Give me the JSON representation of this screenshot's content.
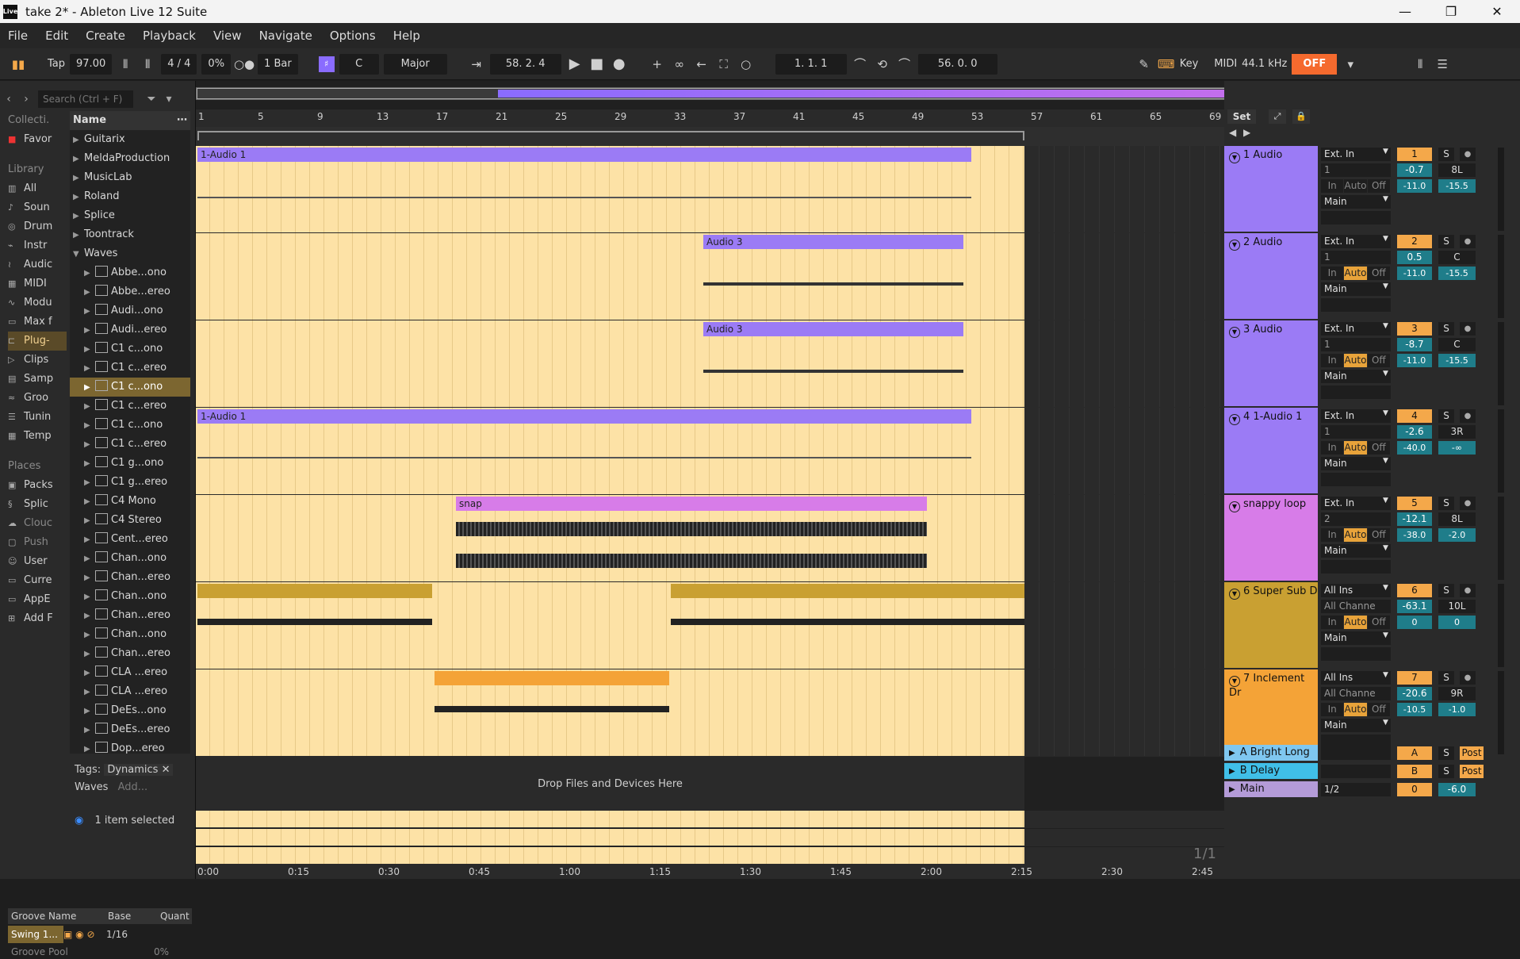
{
  "titlebar": {
    "title": "take 2* - Ableton Live 12 Suite",
    "logo": "Live",
    "min": "—",
    "max": "❐",
    "close": "✕"
  },
  "menu": [
    "File",
    "Edit",
    "Create",
    "Playback",
    "View",
    "Navigate",
    "Options",
    "Help"
  ],
  "control": {
    "tap": "Tap",
    "tempo": "97.00",
    "sig": "4 / 4",
    "groove": "0%",
    "quant": "1 Bar",
    "key": "C",
    "scale": "Major",
    "arr_pos": "58.  2.  4",
    "loop_start": "1.   1.   1",
    "loop_len": "56.   0.   0",
    "key_label": "Key",
    "midi_label": "MIDI",
    "sample_rate": "44.1 kHz",
    "off": "OFF"
  },
  "browser": {
    "search_placeholder": "Search (Ctrl + F)",
    "coll_header": "Collecti.",
    "fav": "Favor",
    "lib_header": "Library",
    "library": [
      "All",
      "Soun",
      "Drum",
      "Instr",
      "Audic",
      "MIDI",
      "Modu",
      "Max f",
      "Plug-",
      "Clips",
      "Samp",
      "Groo",
      "Tunin",
      "Temp"
    ],
    "places_header": "Places",
    "places": [
      "Packs",
      "Splic",
      "Clouc",
      "Push",
      "User",
      "Curre",
      "AppE",
      "Add F"
    ],
    "name_header": "Name",
    "folders": [
      "Guitarix",
      "MeldaProduction",
      "MusicLab",
      "Roland",
      "Splice",
      "Toontrack",
      "Waves"
    ],
    "items": [
      "Abbe...ono",
      "Abbe...ereo",
      "Audi...ono",
      "Audi...ereo",
      "C1 c...ono",
      "C1 c...ereo",
      "C1 c...ono",
      "C1 c...ereo",
      "C1 c...ono",
      "C1 c...ereo",
      "C1 g...ono",
      "C1 g...ereo",
      "C4 Mono",
      "C4 Stereo",
      "Cent...ereo",
      "Chan...ono",
      "Chan...ereo",
      "Chan...ono",
      "Chan...ereo",
      "Chan...ono",
      "Chan...ereo",
      "CLA ...ereo",
      "CLA ...ereo",
      "DeEs...ono",
      "DeEs...ereo",
      "Dop...ereo"
    ],
    "tags_label": "Tags:",
    "tag": "Dynamics",
    "tag_waves": "Waves",
    "tag_add": "Add...",
    "selected": "1 item selected",
    "groove_name": "Groove Name",
    "groove_base": "Base",
    "groove_quant": "Quant",
    "groove_item": "Swing 1...",
    "groove_val": "1/16",
    "groove_pool": "Groove Pool",
    "groove_pct": "0%"
  },
  "ruler": [
    "1",
    "5",
    "9",
    "13",
    "17",
    "21",
    "25",
    "29",
    "33",
    "37",
    "41",
    "45",
    "49",
    "53",
    "57",
    "61",
    "65",
    "69"
  ],
  "time": [
    "0:00",
    "0:15",
    "0:30",
    "0:45",
    "1:00",
    "1:15",
    "1:30",
    "1:45",
    "2:00",
    "2:15",
    "2:30",
    "2:45"
  ],
  "drop": "Drop Files and Devices Here",
  "ratio": "1/1",
  "set": "Set",
  "tracks": [
    {
      "name": "1 Audio",
      "color": "#9b7bf5",
      "in": "Ext. In",
      "ch": "1",
      "out": "Main",
      "num": "1",
      "vol": "-0.7",
      "pan": "8L",
      "l": "-11.0",
      "r": "-15.5",
      "clip": "1-Audio 1"
    },
    {
      "name": "2 Audio",
      "color": "#9b7bf5",
      "in": "Ext. In",
      "ch": "1",
      "out": "Main",
      "num": "2",
      "vol": "0.5",
      "pan": "C",
      "l": "-11.0",
      "r": "-15.5",
      "clip": "Audio 3"
    },
    {
      "name": "3 Audio",
      "color": "#9b7bf5",
      "in": "Ext. In",
      "ch": "1",
      "out": "Main",
      "num": "3",
      "vol": "-8.7",
      "pan": "C",
      "l": "-11.0",
      "r": "-15.5",
      "clip": "Audio 3"
    },
    {
      "name": "4 1-Audio 1",
      "color": "#9b7bf5",
      "in": "Ext. In",
      "ch": "1",
      "out": "Main",
      "num": "4",
      "vol": "-2.6",
      "pan": "3R",
      "l": "-40.0",
      "r": "-∞",
      "clip": "1-Audio 1"
    },
    {
      "name": "snappy loop",
      "color": "#d77ce8",
      "in": "Ext. In",
      "ch": "2",
      "out": "Main",
      "num": "5",
      "vol": "-12.1",
      "pan": "8L",
      "l": "-38.0",
      "r": "-2.0",
      "clip": "snap"
    },
    {
      "name": "6 Super Sub D",
      "color": "#c9a032",
      "in": "All Ins",
      "ch": "All Channe",
      "out": "Main",
      "num": "6",
      "vol": "-63.1",
      "pan": "10L",
      "l": "0",
      "r": "0",
      "clip": ""
    },
    {
      "name": "7 Inclement Dr",
      "color": "#f4a337",
      "in": "All Ins",
      "ch": "All Channe",
      "out": "Main",
      "num": "7",
      "vol": "-20.6",
      "pan": "9R",
      "l": "-10.5",
      "r": "-1.0",
      "clip": ""
    }
  ],
  "io": {
    "in": "In",
    "auto": "Auto",
    "off": "Off",
    "solo": "S"
  },
  "returns": [
    {
      "name": "A Bright Long",
      "color": "#7fc7f0",
      "num": "A",
      "post": "Post"
    },
    {
      "name": "B Delay",
      "color": "#40bfe8",
      "num": "B",
      "post": "Post"
    },
    {
      "name": "Main",
      "color": "#b49bd8",
      "num": "0",
      "out": "1/2",
      "vol": "-6.0"
    }
  ]
}
